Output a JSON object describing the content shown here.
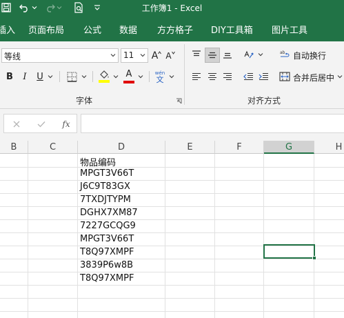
{
  "window": {
    "title": "工作簿1 - Excel"
  },
  "quick_access": {
    "icons": [
      "save-icon",
      "undo-icon",
      "redo-icon",
      "print-preview-icon",
      "customize-icon"
    ]
  },
  "ribbon_tabs": [
    "插入",
    "页面布局",
    "公式",
    "数据",
    "方方格子",
    "DIY工具箱",
    "图片工具"
  ],
  "font_group": {
    "font_name": "等线",
    "font_size": "11",
    "bold": "B",
    "italic": "I",
    "underline": "U",
    "grow_font": "A",
    "shrink_font": "A",
    "font_color_label": "A",
    "phonetic_top": "wén",
    "phonetic_bottom": "文",
    "group_label": "字体"
  },
  "alignment_group": {
    "wrap_text": "自动换行",
    "merge_center": "合并后居中",
    "group_label": "对齐方式"
  },
  "formula_bar": {
    "fx_label": "fx",
    "content": ""
  },
  "columns": [
    "B",
    "C",
    "D",
    "E",
    "F",
    "G",
    "H"
  ],
  "selected_column": "G",
  "cells_d": [
    "物品编码",
    "MPGT3V66T",
    "J6C9T83GX",
    "7TXDJTYPM",
    "DGHX7XM87",
    "7227GCQG9",
    "MPGT3V66T",
    "T8Q97XMPF",
    "3839P6w8B",
    "T8Q97XMPF"
  ],
  "colors": {
    "accent": "#217346",
    "highlight": "#ffff00",
    "font_red": "#e00000"
  }
}
